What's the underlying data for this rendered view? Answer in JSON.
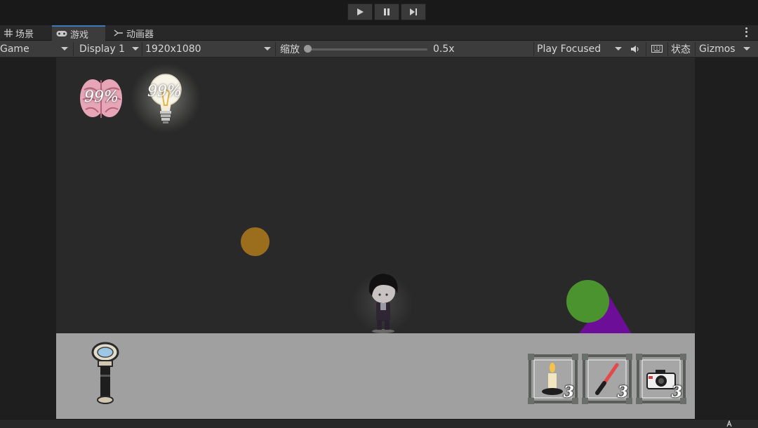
{
  "tabs": [
    {
      "label": "场景",
      "icon": "grid-icon"
    },
    {
      "label": "游戏",
      "icon": "gamepad-icon"
    },
    {
      "label": "动画器",
      "icon": "animator-icon"
    }
  ],
  "toolbar": {
    "view": "Game",
    "display": "Display 1",
    "resolution": "1920x1080",
    "scale_label": "缩放",
    "scale_value": "0.5x",
    "play_mode": "Play Focused",
    "stats": "状态",
    "gizmos": "Gizmos"
  },
  "hud": {
    "sanity_percent": "99%",
    "light_percent": "99%"
  },
  "inventory": [
    {
      "item": "candle",
      "count": "3"
    },
    {
      "item": "lightsaber",
      "count": "3"
    },
    {
      "item": "camera",
      "count": "3"
    }
  ],
  "colors": {
    "orb_yellow": "#9b6e1d",
    "orb_green": "#4a932f",
    "triangle_purple": "#6d0e99",
    "floor": "#a0a0a0",
    "game_bg": "#292929"
  },
  "status_icon": "a-icon"
}
